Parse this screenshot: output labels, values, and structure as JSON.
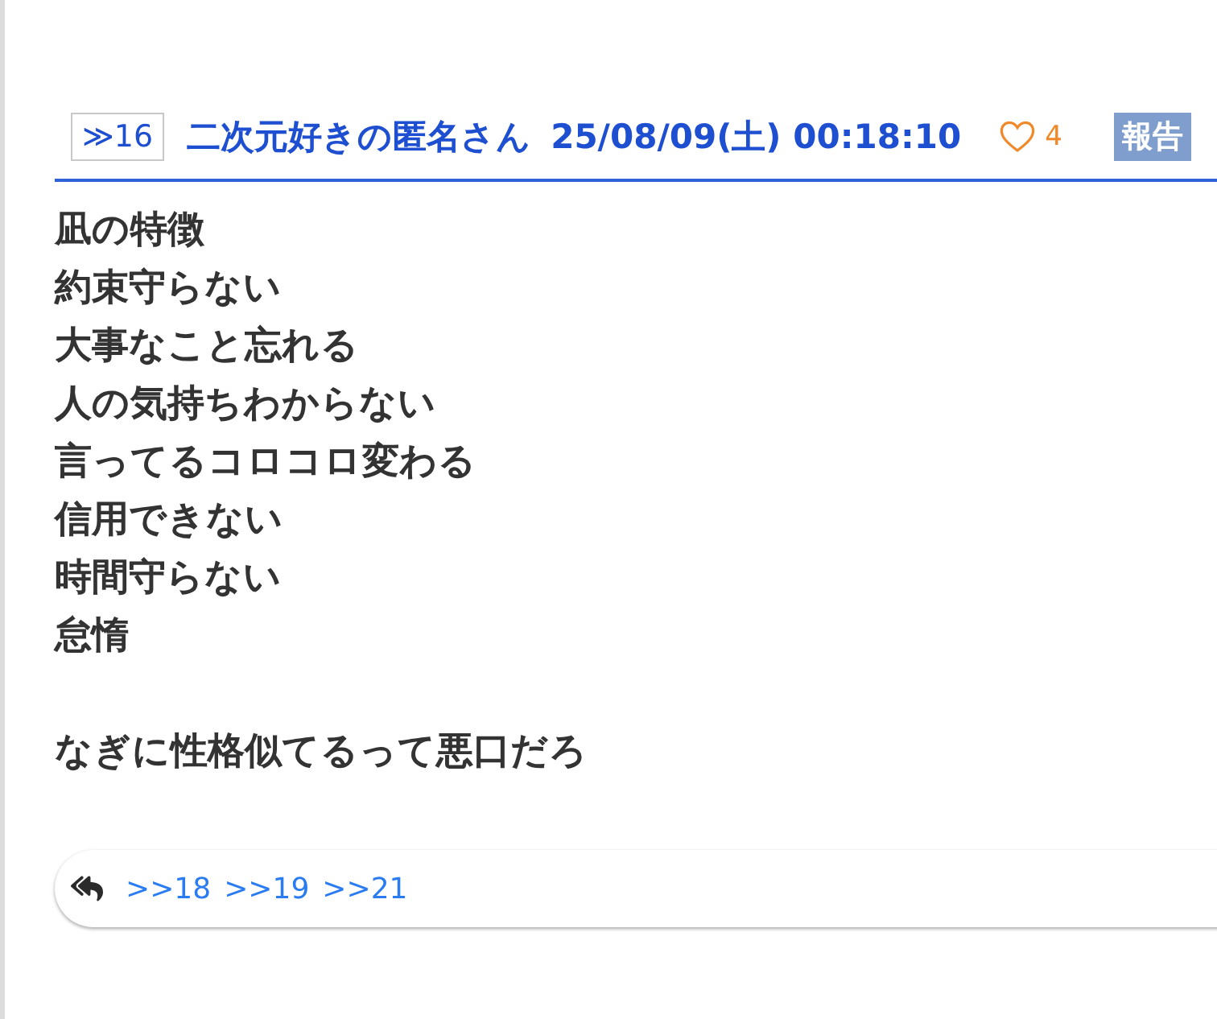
{
  "post": {
    "number": "≫16",
    "author": "二次元好きの匿名さん",
    "timestamp": "25/08/09(土) 00:18:10",
    "likes": "4",
    "report_label": "報告"
  },
  "body": {
    "paragraphs": [
      {
        "lines": [
          "凪の特徴",
          "約束守らない",
          "大事なこと忘れる",
          "人の気持ちわからない",
          "言ってるコロコロ変わる",
          "信用できない",
          "時間守らない",
          "怠惰"
        ]
      },
      {
        "lines": [
          "なぎに性格似てるって悪口だろ"
        ]
      }
    ]
  },
  "replies": {
    "links": [
      ">>18",
      ">>19",
      ">>21"
    ]
  }
}
